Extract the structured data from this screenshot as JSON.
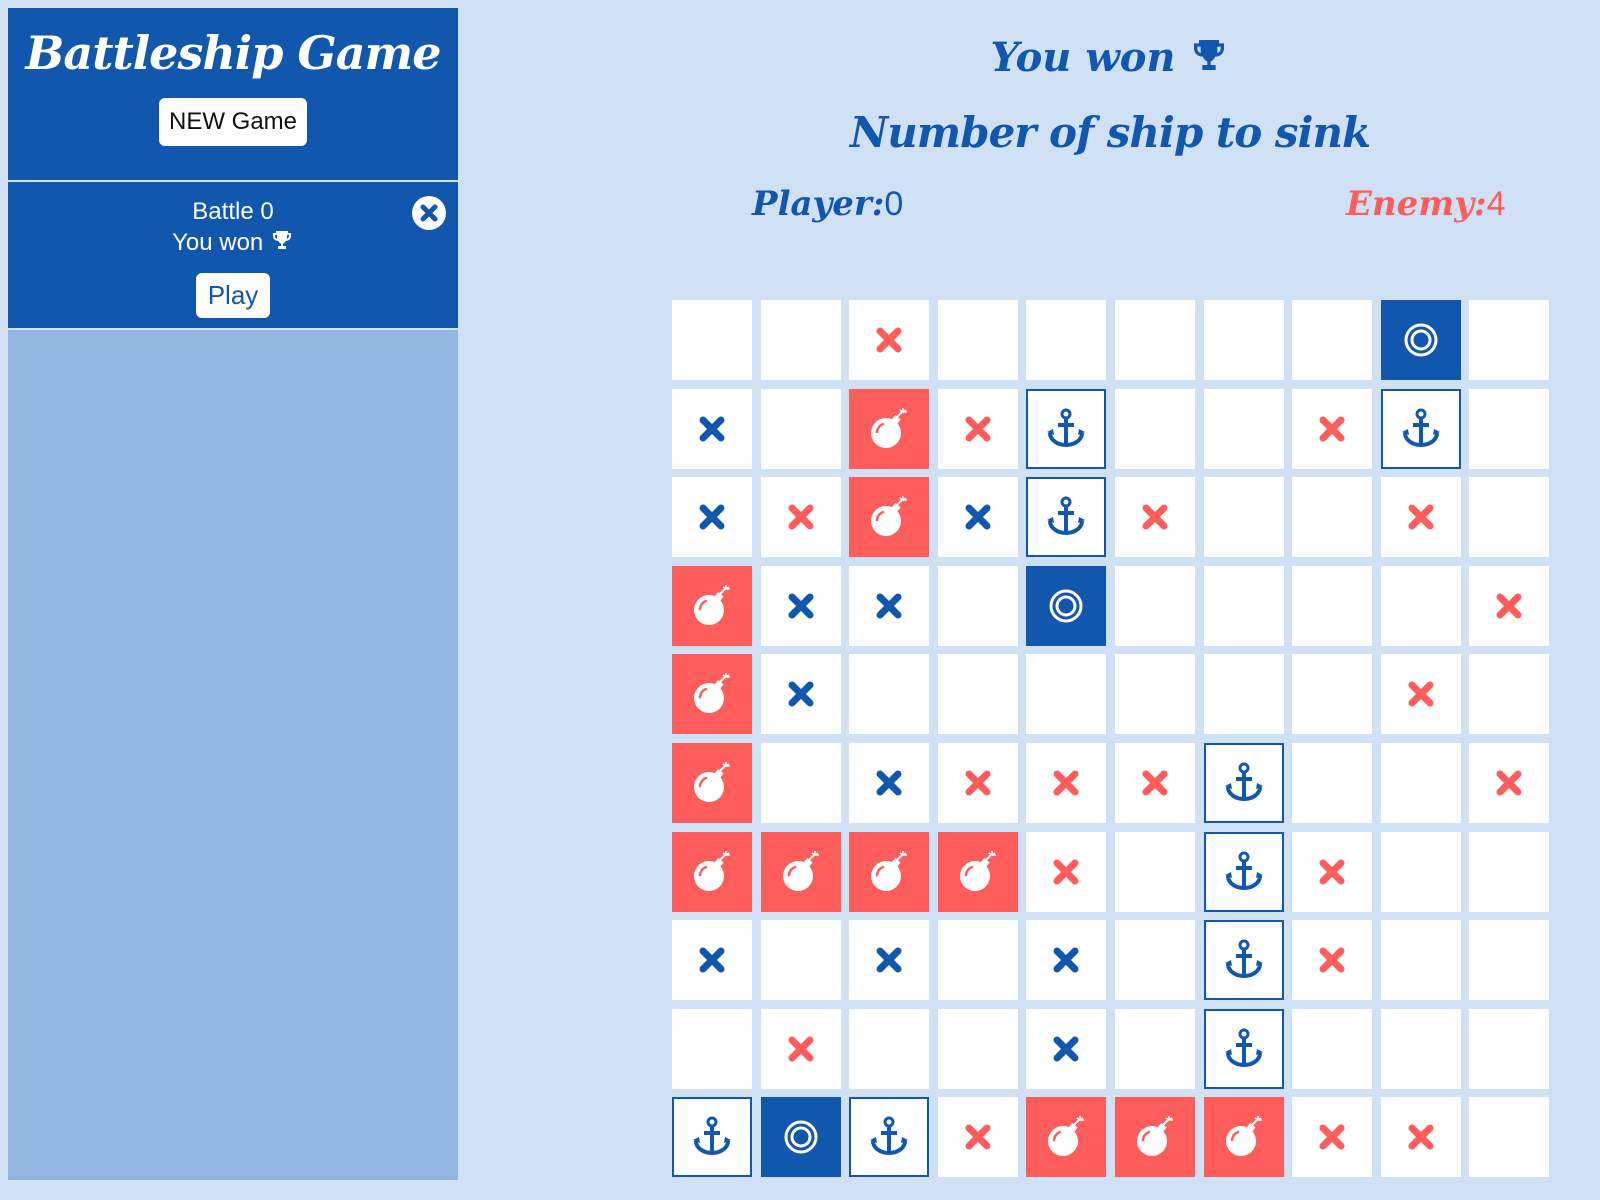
{
  "sidebar": {
    "brand": "Battleship Game",
    "new_game_label": "NEW Game",
    "battles": [
      {
        "name": "Battle 0",
        "status": "You won",
        "status_icon": "trophy-icon",
        "play_label": "Play",
        "close_icon": "close-circle-icon"
      }
    ]
  },
  "main": {
    "result": "You won",
    "result_icon": "trophy-icon",
    "subtitle": "Number of ship to sink",
    "player_label": "Player:",
    "player_value": "0",
    "enemy_label": "Enemy:",
    "enemy_value": "4"
  },
  "colors": {
    "primary": "#1257ae",
    "enemy": "#ff5c5c",
    "background": "#d0e1f6",
    "sidebar_fill": "#93b6e0"
  },
  "legend": {
    "E": "empty",
    "R": "red-miss-x",
    "X": "blue-miss-x",
    "B": "bomb-hit",
    "A": "anchor-ship",
    "T": "target-sunk"
  },
  "board": [
    [
      "E",
      "E",
      "R",
      "E",
      "E",
      "E",
      "E",
      "E",
      "T",
      "E"
    ],
    [
      "X",
      "E",
      "B",
      "R",
      "A",
      "E",
      "E",
      "R",
      "A",
      "E"
    ],
    [
      "X",
      "R",
      "B",
      "X",
      "A",
      "R",
      "E",
      "E",
      "R",
      "E"
    ],
    [
      "B",
      "X",
      "X",
      "E",
      "T",
      "E",
      "E",
      "E",
      "E",
      "R"
    ],
    [
      "B",
      "X",
      "E",
      "E",
      "E",
      "E",
      "E",
      "E",
      "R",
      "E"
    ],
    [
      "B",
      "E",
      "X",
      "R",
      "R",
      "R",
      "A",
      "E",
      "E",
      "R"
    ],
    [
      "B",
      "B",
      "B",
      "B",
      "R",
      "E",
      "A",
      "R",
      "E",
      "E"
    ],
    [
      "X",
      "E",
      "X",
      "E",
      "X",
      "E",
      "A",
      "R",
      "E",
      "E"
    ],
    [
      "E",
      "R",
      "E",
      "E",
      "X",
      "E",
      "A",
      "E",
      "E",
      "E"
    ],
    [
      "A",
      "T",
      "A",
      "R",
      "B",
      "B",
      "B",
      "R",
      "R",
      "E"
    ]
  ]
}
